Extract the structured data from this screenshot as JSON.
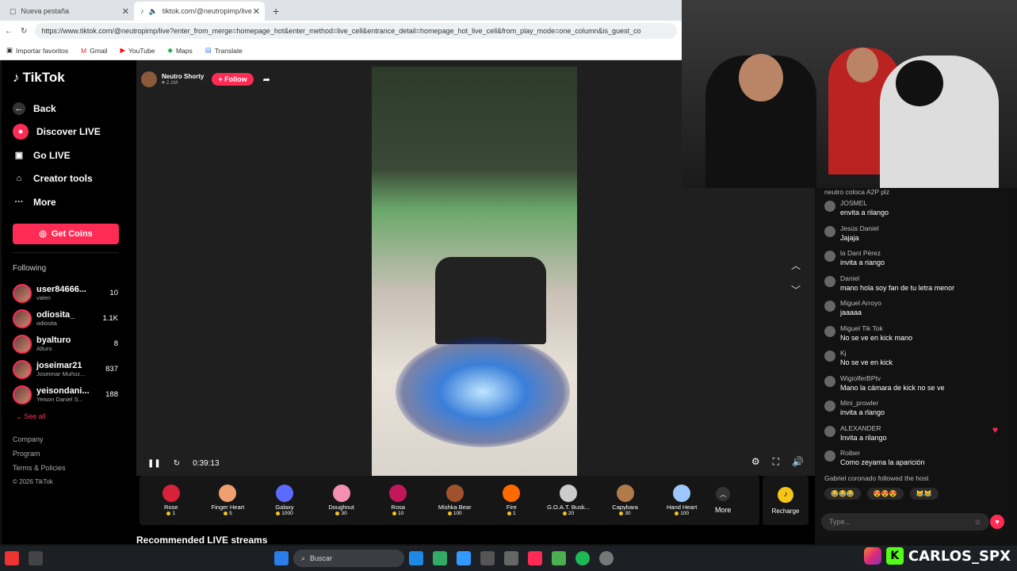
{
  "browser": {
    "tabs": [
      {
        "label": "Nueva pestaña"
      },
      {
        "label": "tiktok.com/@neutropimp/live"
      }
    ],
    "url": "https://www.tiktok.com/@neutropimp/live?enter_from_merge=homepage_hot&enter_method=live_cell&entrance_detail=homepage_hot_live_cell&from_play_mode=one_column&is_guest_co",
    "bookmarks": [
      "Importar favoritos",
      "Gmail",
      "YouTube",
      "Maps",
      "Translate"
    ]
  },
  "sidebar": {
    "logo": "TikTok",
    "nav": [
      {
        "label": "Back",
        "icon": "arrow-left-icon"
      },
      {
        "label": "Discover LIVE",
        "icon": "live-icon"
      },
      {
        "label": "Go LIVE",
        "icon": "camera-icon"
      },
      {
        "label": "Creator tools",
        "icon": "lightbulb-icon"
      },
      {
        "label": "More",
        "icon": "ellipsis-icon"
      }
    ],
    "get_coins": "Get Coins",
    "following_header": "Following",
    "following": [
      {
        "name": "user84666...",
        "sub": "valen",
        "count": "10"
      },
      {
        "name": "odiosita_",
        "sub": "odiosita",
        "count": "1.1K"
      },
      {
        "name": "byalturo",
        "sub": "Alturo",
        "count": "8"
      },
      {
        "name": "joseimar21",
        "sub": "Joseimar Muñoz...",
        "count": "837"
      },
      {
        "name": "yeisondani...",
        "sub": "Yeison Daniel S...",
        "count": "188"
      }
    ],
    "see_all": "See all",
    "footer": [
      "Company",
      "Program",
      "Terms & Policies"
    ],
    "copyright": "© 2026 TikTok"
  },
  "player": {
    "host_name": "Neutro Shorty",
    "host_likes": "2.1M",
    "follow_label": "+ Follow",
    "time": "0:39:13"
  },
  "gifts": [
    {
      "name": "Rose",
      "price": "1",
      "color": "#d6223a"
    },
    {
      "name": "Finger Heart",
      "price": "5",
      "color": "#f0a070"
    },
    {
      "name": "Galaxy",
      "price": "1000",
      "color": "#5b6bff"
    },
    {
      "name": "Doughnut",
      "price": "30",
      "color": "#f48fb1"
    },
    {
      "name": "Rosa",
      "price": "10",
      "color": "#c2185b"
    },
    {
      "name": "Mishka Bear",
      "price": "100",
      "color": "#a0522d"
    },
    {
      "name": "Fire",
      "price": "1",
      "color": "#ff6a00"
    },
    {
      "name": "G.O.A.T. Busk...",
      "price": "20",
      "color": "#cccccc"
    },
    {
      "name": "Capybara",
      "price": "30",
      "color": "#b07a4a"
    },
    {
      "name": "Hand Heart",
      "price": "100",
      "color": "#9ec7ff"
    }
  ],
  "more_label": "More",
  "recharge_label": "Recharge",
  "recommended": "Recommended LIVE streams",
  "chat": {
    "top_partial": "neutro coloca A2P plz",
    "messages": [
      {
        "user": "JOSMEL",
        "text": "envita a rilango"
      },
      {
        "user": "Jesús Daniel",
        "text": "Jajaja"
      },
      {
        "user": "la Dani Pérez",
        "text": "invita a riango"
      },
      {
        "user": "Daniel",
        "text": "mano hola soy fan de tu letra menor"
      },
      {
        "user": "Miguel Arroyo",
        "text": "jaaaaa"
      },
      {
        "user": "Miguel Tik Tok",
        "text": "No se ve en kick mano"
      },
      {
        "user": "Kj",
        "text": "No se ve en kick"
      },
      {
        "user": "WigiolferBPtv",
        "text": "Mano la cámara de kick no se ve"
      },
      {
        "user": "Mini_prowler",
        "text": "invita a rlango"
      },
      {
        "user": "ALEXANDER",
        "text": "Invita a rilango"
      },
      {
        "user": "Roiber",
        "text": "Como zeyama la aparición"
      }
    ],
    "bottom_partial": "Gabriel coronado followed the host",
    "type_placeholder": "Type..."
  },
  "taskbar": {
    "search": "Buscar"
  },
  "brand": "CARLOS_SPX"
}
